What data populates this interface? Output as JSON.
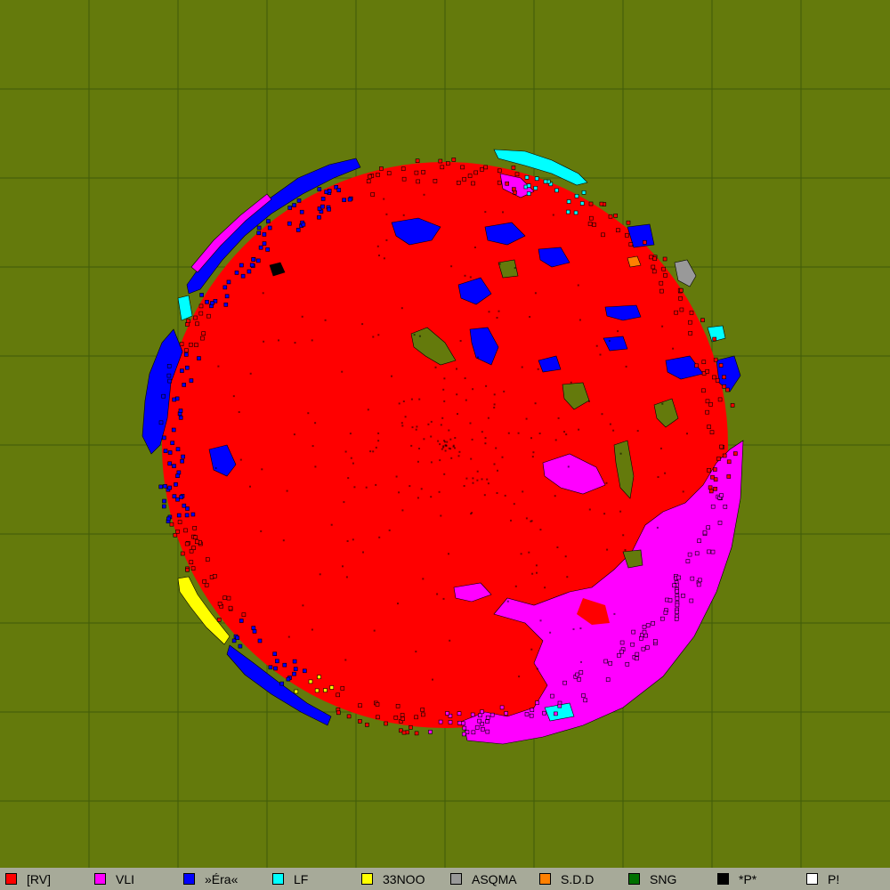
{
  "map": {
    "background_color": "#647a0c",
    "grid_color": "#3e5a0a",
    "cell_outline_color": "#000000"
  },
  "legend": {
    "items": [
      {
        "label": "[RV]",
        "color": "#ff0000"
      },
      {
        "label": "VLI",
        "color": "#ff00ff"
      },
      {
        "label": "»Éra«",
        "color": "#0000ff"
      },
      {
        "label": "LF",
        "color": "#00ffff"
      },
      {
        "label": "33NOO",
        "color": "#ffff00"
      },
      {
        "label": "ASQMA",
        "color": "#999999"
      },
      {
        "label": "S.D.D",
        "color": "#ff8000"
      },
      {
        "label": "SNG",
        "color": "#007000"
      },
      {
        "label": "*P*",
        "color": "#000000"
      },
      {
        "label": "P!",
        "color": "#ffffff"
      }
    ]
  }
}
